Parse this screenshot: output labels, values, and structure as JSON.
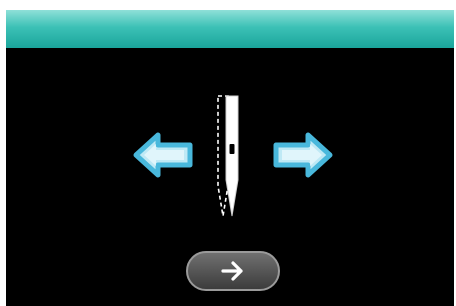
{
  "header": {
    "title": "",
    "color": "#3cc1b6"
  },
  "controls": {
    "left_icon": "arrow-left-icon",
    "right_icon": "arrow-right-icon",
    "needle_icon": "needle-position-icon",
    "next_icon": "arrow-right-icon",
    "arrow_color": "#5ec8e8"
  }
}
